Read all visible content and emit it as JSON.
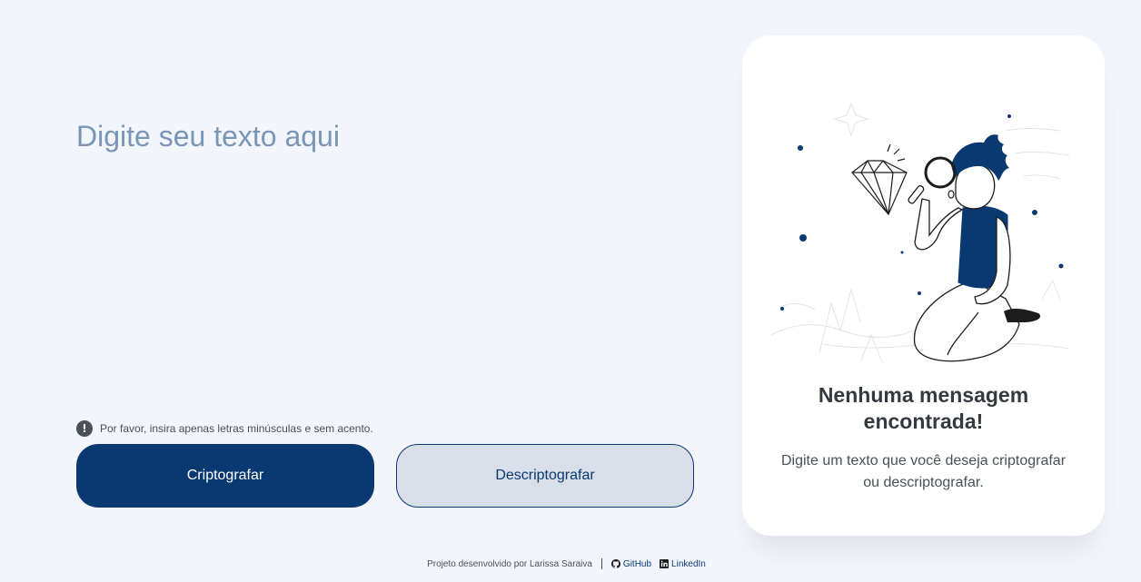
{
  "input": {
    "placeholder": "Digite seu texto aqui",
    "value": ""
  },
  "hint": {
    "icon": "exclamation-circle-icon",
    "text": "Por favor, insira apenas letras minúsculas e sem acento."
  },
  "buttons": {
    "encrypt_label": "Criptografar",
    "decrypt_label": "Descriptografar"
  },
  "output_panel": {
    "illustration": "person-with-magnifying-glass-and-diamond",
    "title": "Nenhuma mensagem encontrada!",
    "text": "Digite um texto que você deseja criptografar ou descriptografar."
  },
  "footer": {
    "credit": "Projeto desenvolvido por Larissa Saraiva",
    "github_label": "GitHub",
    "github_icon": "github-icon",
    "linkedin_label": "LinkedIn",
    "linkedin_icon": "linkedin-icon"
  },
  "colors": {
    "background": "#f3f5fc",
    "primary": "#0a3871",
    "secondary_button": "#d8dfe8",
    "placeholder": "#7a95b5",
    "card": "#ffffff"
  }
}
